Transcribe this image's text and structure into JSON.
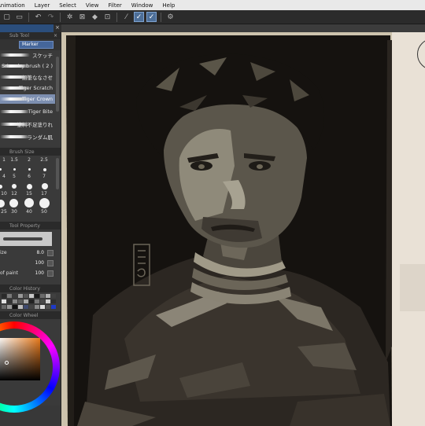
{
  "menu": [
    "Animation",
    "Layer",
    "Select",
    "View",
    "Filter",
    "Window",
    "Help"
  ],
  "toolbar_icons": [
    "new-icon",
    "save-icon",
    "undo-icon",
    "redo-icon",
    "lasso-icon",
    "clear-icon",
    "fill-icon",
    "transform-icon",
    "stabilizer-icon",
    "snap-icon",
    "snap-icon",
    "settings-icon"
  ],
  "sub_tool": {
    "title": "Sub Tool",
    "group": "Marker",
    "brushes": [
      "スケッチ",
      "Srixx dry brush ( 2 )",
      "鉛筆ななさせ",
      "Tiger Scratch",
      "Tiger Crown",
      "Tiger Bite",
      "塗料不足塗りれ",
      "ランダム肌"
    ]
  },
  "brush_size": {
    "title": "Brush Size",
    "values": [
      "1",
      "1.5",
      "2",
      "2.5",
      "4",
      "5",
      "6",
      "7",
      "10",
      "12",
      "15",
      "17",
      "25",
      "30",
      "40",
      "50"
    ]
  },
  "tool_property": {
    "title": "Tool Property",
    "size_label": "ize",
    "size_value": "8.0",
    "row2_value": "100",
    "row3_label": "of paint",
    "row3_value": "100"
  },
  "color_history": {
    "title": "Color History"
  },
  "color_wheel": {
    "title": "Color Wheel"
  },
  "colors": {
    "accent": "#4d6f99",
    "selected_brush": "#7d8fb0",
    "main_color": "#e87a1c",
    "paper": "#cdc3ad",
    "ink": "#15120f"
  }
}
